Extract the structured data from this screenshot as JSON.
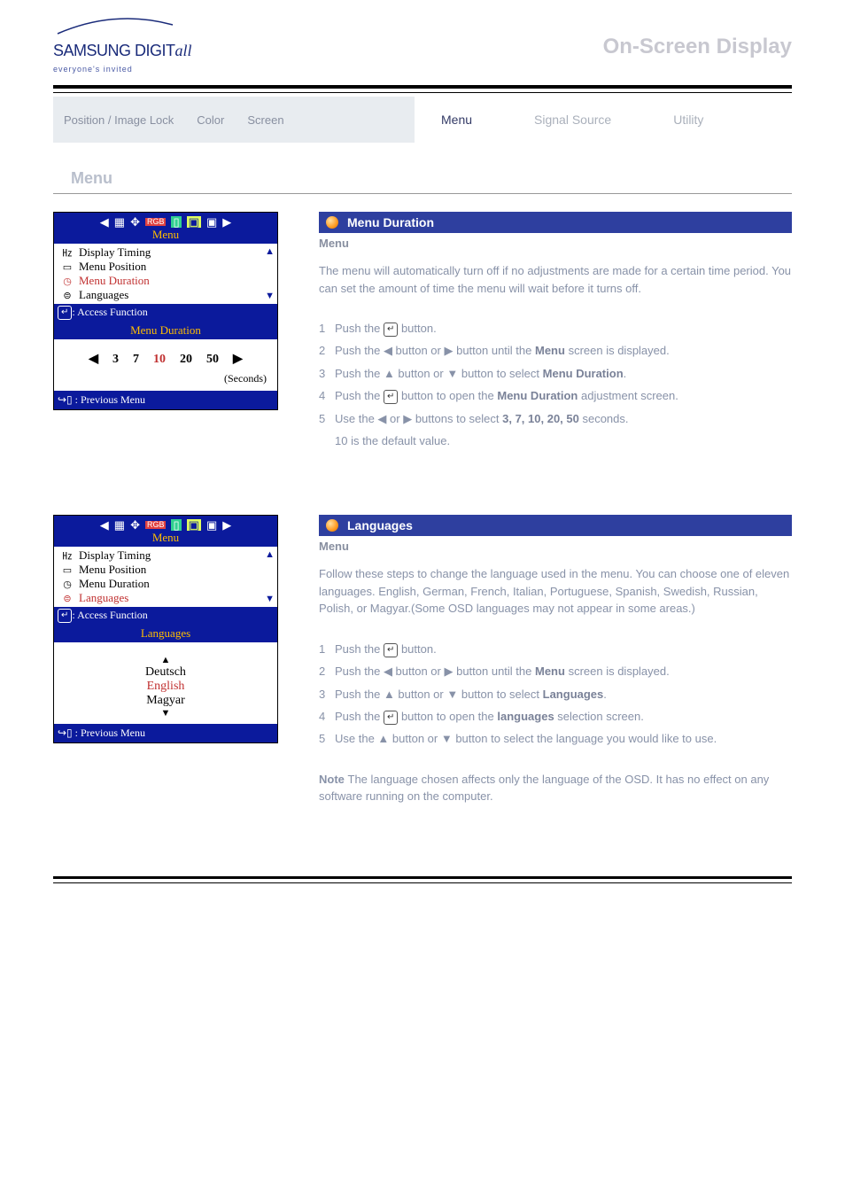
{
  "header": {
    "logo_main": "SAMSUNG DIGIT",
    "logo_suffix": "all",
    "logo_tagline": "everyone's invited",
    "title": "On-Screen Display"
  },
  "tabs": {
    "left": [
      "Position / Image Lock",
      "Color",
      "Screen"
    ],
    "right": [
      "Menu",
      "Signal Source",
      "Utility"
    ],
    "active_right": "Menu"
  },
  "section_heading": "Menu",
  "osd_common": {
    "top_label": "Menu",
    "access_label": ": Access Function",
    "previous_label": " : Previous Menu",
    "items": [
      "Display Timing",
      "Menu Position",
      "Menu Duration",
      "Languages"
    ]
  },
  "block1": {
    "selected_item_index": 2,
    "sub_title": "Menu Duration",
    "values": [
      "3",
      "7",
      "10",
      "20",
      "50"
    ],
    "selected_value_index": 2,
    "seconds_label": "(Seconds)",
    "feature_title": "Menu Duration",
    "right_menu_label": "Menu",
    "desc": "The menu will automatically turn off if no adjustments are made for a certain time period. You can set the amount of time the menu will wait before it turns off.",
    "steps": [
      {
        "n": "1",
        "t": "Push the ",
        "sym": "↵",
        "t2": " button."
      },
      {
        "n": "2",
        "t": "Push the ",
        "tri": "◀",
        "t2": " button or ",
        "tri2": "▶",
        "t3": " button until the ",
        "b": "Menu",
        "t4": " screen is displayed."
      },
      {
        "n": "3",
        "t": "Push the ",
        "tri": "▲",
        "t2": " button or ",
        "tri2": "▼",
        "t3": " button to select ",
        "b": "Menu Duration",
        "t4": "."
      },
      {
        "n": "4",
        "t": "Push the ",
        "sym": "↵",
        "t2": " button to open the ",
        "b": "Menu Duration",
        "t3": " adjustment screen."
      },
      {
        "n": "5",
        "t": "Use the ",
        "tri": "◀",
        "t2": " or ",
        "tri2": "▶",
        "t3": " buttons to select ",
        "b": "3, 7, 10, 20, 50",
        "t4": " seconds."
      },
      {
        "n": "",
        "t": "10 is the default value."
      }
    ]
  },
  "block2": {
    "selected_item_index": 3,
    "sub_title": "Languages",
    "lang_values": [
      "Deutsch",
      "English",
      "Magyar"
    ],
    "selected_lang_index": 1,
    "feature_title": "Languages",
    "right_menu_label": "Menu",
    "desc": "Follow these steps to change the language used in the menu. You can choose one of eleven languages. English, German, French, Italian, Portuguese, Spanish, Swedish, Russian, Polish, or Magyar.(Some OSD languages may not appear in some areas.)",
    "steps": [
      {
        "n": "1",
        "t": "Push the ",
        "sym": "↵",
        "t2": " button."
      },
      {
        "n": "2",
        "t": "Push the ",
        "tri": "◀",
        "t2": " button or ",
        "tri2": "▶",
        "t3": " button until the ",
        "b": "Menu",
        "t4": " screen is displayed."
      },
      {
        "n": "3",
        "t": "Push the ",
        "tri": "▲",
        "t2": " button or ",
        "tri2": "▼",
        "t3": " button to select ",
        "b": "Languages",
        "t4": "."
      },
      {
        "n": "4",
        "t": "Push the ",
        "sym": "↵",
        "t2": " button to open the ",
        "b": "languages",
        "t3": " selection screen."
      },
      {
        "n": "5",
        "t": "Use the ",
        "tri": "▲",
        "t2": " button or ",
        "tri2": "▼",
        "t3": " button to select the language you would like to use."
      }
    ],
    "note_label": "Note",
    "note_text": "The language chosen affects only the language of the OSD. It has no effect on any software running on the computer."
  }
}
